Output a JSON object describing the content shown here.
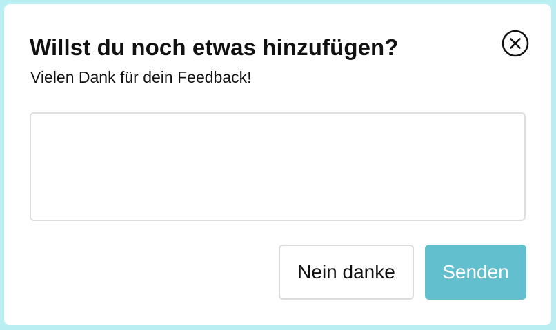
{
  "dialog": {
    "title": "Willst du noch etwas hinzufügen?",
    "subtitle": "Vielen Dank für dein Feedback!",
    "close_icon": "close-circle-icon",
    "feedback_value": "",
    "feedback_placeholder": "",
    "decline_label": "Nein danke",
    "submit_label": "Senden"
  },
  "colors": {
    "backdrop": "#b9eef2",
    "primary_button": "#62bfcd",
    "text": "#111111"
  }
}
